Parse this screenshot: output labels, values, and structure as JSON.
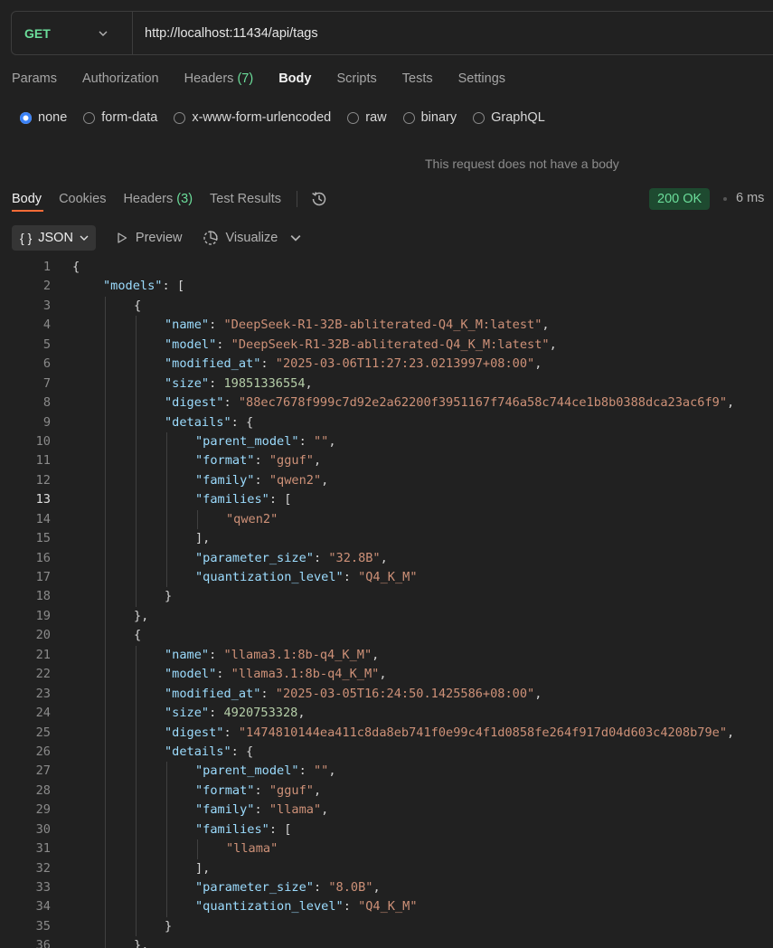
{
  "request": {
    "method": "GET",
    "url": "http://localhost:11434/api/tags",
    "tabs": [
      {
        "label": "Params",
        "count": ""
      },
      {
        "label": "Authorization",
        "count": ""
      },
      {
        "label": "Headers ",
        "count": "(7)"
      },
      {
        "label": "Body",
        "count": ""
      },
      {
        "label": "Scripts",
        "count": ""
      },
      {
        "label": "Tests",
        "count": ""
      },
      {
        "label": "Settings",
        "count": ""
      }
    ],
    "body_types": [
      "none",
      "form-data",
      "x-www-form-urlencoded",
      "raw",
      "binary",
      "GraphQL"
    ],
    "no_body_message": "This request does not have a body"
  },
  "response": {
    "tabs": {
      "body": "Body",
      "cookies": "Cookies",
      "headers": "Headers ",
      "headers_count": "(3)",
      "test_results": "Test Results"
    },
    "status": "200 OK",
    "time": "6 ms",
    "format": "JSON",
    "preview": "Preview",
    "visualize": "Visualize"
  },
  "code": {
    "current_line": 13,
    "lines": [
      {
        "indent": 0,
        "parts": [
          [
            "p",
            "{"
          ]
        ]
      },
      {
        "indent": 1,
        "parts": [
          [
            "k",
            "\"models\""
          ],
          [
            "p",
            ": ["
          ]
        ]
      },
      {
        "indent": 2,
        "parts": [
          [
            "p",
            "{"
          ]
        ]
      },
      {
        "indent": 3,
        "parts": [
          [
            "k",
            "\"name\""
          ],
          [
            "p",
            ": "
          ],
          [
            "s",
            "\"DeepSeek-R1-32B-abliterated-Q4_K_M:latest\""
          ],
          [
            "p",
            ","
          ]
        ]
      },
      {
        "indent": 3,
        "parts": [
          [
            "k",
            "\"model\""
          ],
          [
            "p",
            ": "
          ],
          [
            "s",
            "\"DeepSeek-R1-32B-abliterated-Q4_K_M:latest\""
          ],
          [
            "p",
            ","
          ]
        ]
      },
      {
        "indent": 3,
        "parts": [
          [
            "k",
            "\"modified_at\""
          ],
          [
            "p",
            ": "
          ],
          [
            "s",
            "\"2025-03-06T11:27:23.0213997+08:00\""
          ],
          [
            "p",
            ","
          ]
        ]
      },
      {
        "indent": 3,
        "parts": [
          [
            "k",
            "\"size\""
          ],
          [
            "p",
            ": "
          ],
          [
            "n",
            "19851336554"
          ],
          [
            "p",
            ","
          ]
        ]
      },
      {
        "indent": 3,
        "parts": [
          [
            "k",
            "\"digest\""
          ],
          [
            "p",
            ": "
          ],
          [
            "s",
            "\"88ec7678f999c7d92e2a62200f3951167f746a58c744ce1b8b0388dca23ac6f9\""
          ],
          [
            "p",
            ","
          ]
        ]
      },
      {
        "indent": 3,
        "parts": [
          [
            "k",
            "\"details\""
          ],
          [
            "p",
            ": {"
          ]
        ]
      },
      {
        "indent": 4,
        "parts": [
          [
            "k",
            "\"parent_model\""
          ],
          [
            "p",
            ": "
          ],
          [
            "s",
            "\"\""
          ],
          [
            "p",
            ","
          ]
        ]
      },
      {
        "indent": 4,
        "parts": [
          [
            "k",
            "\"format\""
          ],
          [
            "p",
            ": "
          ],
          [
            "s",
            "\"gguf\""
          ],
          [
            "p",
            ","
          ]
        ]
      },
      {
        "indent": 4,
        "parts": [
          [
            "k",
            "\"family\""
          ],
          [
            "p",
            ": "
          ],
          [
            "s",
            "\"qwen2\""
          ],
          [
            "p",
            ","
          ]
        ]
      },
      {
        "indent": 4,
        "parts": [
          [
            "k",
            "\"families\""
          ],
          [
            "p",
            ": ["
          ]
        ]
      },
      {
        "indent": 5,
        "parts": [
          [
            "s",
            "\"qwen2\""
          ]
        ]
      },
      {
        "indent": 4,
        "parts": [
          [
            "p",
            "],"
          ]
        ]
      },
      {
        "indent": 4,
        "parts": [
          [
            "k",
            "\"parameter_size\""
          ],
          [
            "p",
            ": "
          ],
          [
            "s",
            "\"32.8B\""
          ],
          [
            "p",
            ","
          ]
        ]
      },
      {
        "indent": 4,
        "parts": [
          [
            "k",
            "\"quantization_level\""
          ],
          [
            "p",
            ": "
          ],
          [
            "s",
            "\"Q4_K_M\""
          ]
        ]
      },
      {
        "indent": 3,
        "parts": [
          [
            "p",
            "}"
          ]
        ]
      },
      {
        "indent": 2,
        "parts": [
          [
            "p",
            "},"
          ]
        ]
      },
      {
        "indent": 2,
        "parts": [
          [
            "p",
            "{"
          ]
        ]
      },
      {
        "indent": 3,
        "parts": [
          [
            "k",
            "\"name\""
          ],
          [
            "p",
            ": "
          ],
          [
            "s",
            "\"llama3.1:8b-q4_K_M\""
          ],
          [
            "p",
            ","
          ]
        ]
      },
      {
        "indent": 3,
        "parts": [
          [
            "k",
            "\"model\""
          ],
          [
            "p",
            ": "
          ],
          [
            "s",
            "\"llama3.1:8b-q4_K_M\""
          ],
          [
            "p",
            ","
          ]
        ]
      },
      {
        "indent": 3,
        "parts": [
          [
            "k",
            "\"modified_at\""
          ],
          [
            "p",
            ": "
          ],
          [
            "s",
            "\"2025-03-05T16:24:50.1425586+08:00\""
          ],
          [
            "p",
            ","
          ]
        ]
      },
      {
        "indent": 3,
        "parts": [
          [
            "k",
            "\"size\""
          ],
          [
            "p",
            ": "
          ],
          [
            "n",
            "4920753328"
          ],
          [
            "p",
            ","
          ]
        ]
      },
      {
        "indent": 3,
        "parts": [
          [
            "k",
            "\"digest\""
          ],
          [
            "p",
            ": "
          ],
          [
            "s",
            "\"1474810144ea411c8da8eb741f0e99c4f1d0858fe264f917d04d603c4208b79e\""
          ],
          [
            "p",
            ","
          ]
        ]
      },
      {
        "indent": 3,
        "parts": [
          [
            "k",
            "\"details\""
          ],
          [
            "p",
            ": {"
          ]
        ]
      },
      {
        "indent": 4,
        "parts": [
          [
            "k",
            "\"parent_model\""
          ],
          [
            "p",
            ": "
          ],
          [
            "s",
            "\"\""
          ],
          [
            "p",
            ","
          ]
        ]
      },
      {
        "indent": 4,
        "parts": [
          [
            "k",
            "\"format\""
          ],
          [
            "p",
            ": "
          ],
          [
            "s",
            "\"gguf\""
          ],
          [
            "p",
            ","
          ]
        ]
      },
      {
        "indent": 4,
        "parts": [
          [
            "k",
            "\"family\""
          ],
          [
            "p",
            ": "
          ],
          [
            "s",
            "\"llama\""
          ],
          [
            "p",
            ","
          ]
        ]
      },
      {
        "indent": 4,
        "parts": [
          [
            "k",
            "\"families\""
          ],
          [
            "p",
            ": ["
          ]
        ]
      },
      {
        "indent": 5,
        "parts": [
          [
            "s",
            "\"llama\""
          ]
        ]
      },
      {
        "indent": 4,
        "parts": [
          [
            "p",
            "],"
          ]
        ]
      },
      {
        "indent": 4,
        "parts": [
          [
            "k",
            "\"parameter_size\""
          ],
          [
            "p",
            ": "
          ],
          [
            "s",
            "\"8.0B\""
          ],
          [
            "p",
            ","
          ]
        ]
      },
      {
        "indent": 4,
        "parts": [
          [
            "k",
            "\"quantization_level\""
          ],
          [
            "p",
            ": "
          ],
          [
            "s",
            "\"Q4_K_M\""
          ]
        ]
      },
      {
        "indent": 3,
        "parts": [
          [
            "p",
            "}"
          ]
        ]
      },
      {
        "indent": 2,
        "parts": [
          [
            "p",
            "},"
          ]
        ]
      }
    ]
  }
}
